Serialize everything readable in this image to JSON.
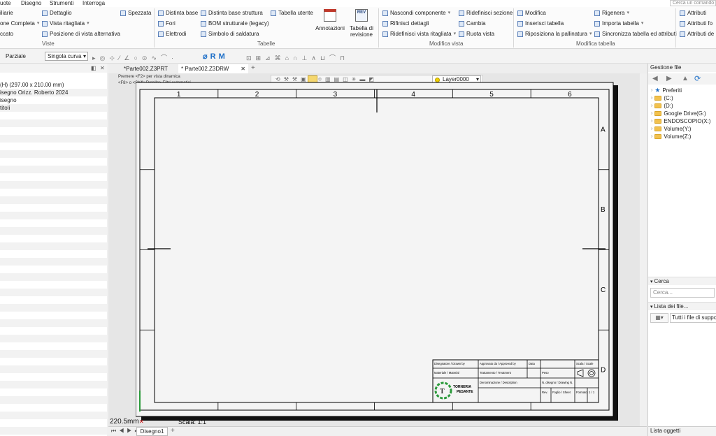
{
  "menu": {
    "items": [
      "uote",
      "Disegno",
      "Strumenti",
      "Interroga"
    ]
  },
  "search_top": {
    "placeholder": "Cerca un comando"
  },
  "ribbon": {
    "viste": {
      "label": "Viste",
      "items": [
        "iliarie",
        "one Completa",
        "ccato",
        "Dettaglio",
        "Vista ritagliata",
        "Posizione di vista alternativa",
        "Spezzata"
      ]
    },
    "tabelle": {
      "label": "Tabelle",
      "items": [
        "Distinta base",
        "Fori",
        "Elettrodi",
        "Distinta base struttura",
        "BOM strutturale (legacy)",
        "Simbolo di saldatura",
        "Tabella utente",
        "Annotazioni",
        "Tabella di revisione"
      ]
    },
    "modifica_vista": {
      "label": "Modifica vista",
      "items": [
        "Nascondi componente",
        "Rifinisci dettagli",
        "Ridefinisci vista ritagliata",
        "Ridefinisci sezione",
        "Cambia",
        "Ruota vista"
      ]
    },
    "modifica_tabella": {
      "label": "Modifica tabella",
      "items": [
        "Modifica",
        "Inserisci tabella",
        "Riposiziona la pallinatura",
        "Rigenera",
        "Importa tabella",
        "Sincronizza tabella ed attributi"
      ]
    },
    "attributi": {
      "items": [
        "Attributi",
        "Attributi fo",
        "Attributi de"
      ]
    }
  },
  "toolbar2": {
    "filter_label": "Parziale",
    "curve_select": "Singola curva"
  },
  "left_panel": {
    "rows": [
      "(H) (297.00 x 210.00 mm)",
      "isegno Orizz. Roberto 2024",
      "isegno",
      "titoli"
    ]
  },
  "tabs": [
    "*Parte002.Z3PRT",
    "* Parte002.Z3DRW"
  ],
  "canvas": {
    "hint1": "Premere <F2> per vista dinamica",
    "hint2": "<F8> o <Shift+Rotella> Filtri automatici",
    "layer": "Layer0000",
    "coord": "220.5mm",
    "scale": "Scala: 1:1"
  },
  "sheet": {
    "columns": [
      "1",
      "2",
      "3",
      "4",
      "5",
      "6"
    ],
    "rows": [
      "A",
      "B",
      "C",
      "D"
    ],
    "title_block": {
      "drawn_by": "Disegnatore / Drawn by",
      "approved_by": "Approvato da / Approved by",
      "date": "Data",
      "scale": "Scala / Scale",
      "material": "Materiale / Material",
      "treatment": "Trattamento / Treatment",
      "weight": "Peso",
      "designation": "Denominazione / Description",
      "drawing_no": "N. disegno / Drawing N.",
      "rev": "Rev.",
      "sheet": "Foglio / Sheet",
      "format": "Formato",
      "sheet_count": "1 / 1",
      "company_line1": "TORNERIA",
      "company_line2": "PESANTE"
    }
  },
  "bottom": {
    "sheet_tab": "Disegno1"
  },
  "right_panel": {
    "title": "Gestione file",
    "tree": [
      "Preferiti",
      "(C:)",
      "(D:)",
      "Google Drive(G:)",
      "ENDOSCOPIO(X:)",
      "Volume(Y:)",
      "Volume(Z:)"
    ],
    "search_title": "Cerca",
    "search_placeholder": "Cerca...",
    "file_list_title": "Lista dei file...",
    "file_filter": "Tutti i file di suppo",
    "objects_title": "Lista oggetti"
  },
  "colors": {
    "accent": "#1e6fc8",
    "folder": "#f2c14e",
    "logo_green": "#2a9a3a"
  }
}
